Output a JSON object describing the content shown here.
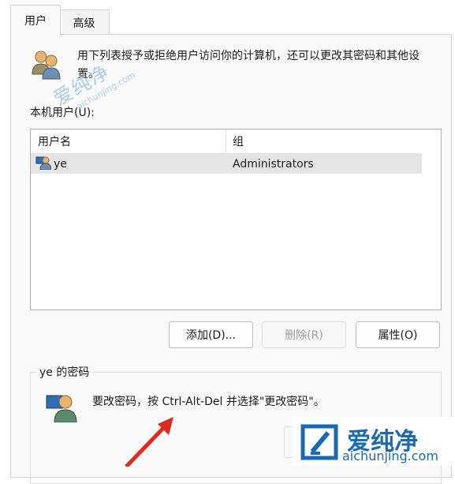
{
  "tabs": [
    {
      "label": "用户",
      "active": true
    },
    {
      "label": "高级",
      "active": false
    }
  ],
  "description": "用下列表授予或拒绝用户访问你的计算机，还可以更改其密码和其他设置。",
  "users_label": "本机用户(U):",
  "table": {
    "columns": [
      "用户名",
      "组"
    ],
    "rows": [
      {
        "user": "ye",
        "group": "Administrators"
      }
    ]
  },
  "buttons": {
    "add": "添加(D)...",
    "remove": "删除(R)",
    "properties": "属性(O)"
  },
  "password_group": {
    "title": "ye 的密码",
    "text": "要改密码，按 Ctrl-Alt-Del 并选择\"更改密码\"。"
  },
  "watermark": {
    "text": "爱纯净",
    "url": "aichunjing.com"
  },
  "logo": {
    "text": "爱纯净",
    "url": "aichunjing.com"
  },
  "colors": {
    "accent": "#1b6ab1",
    "arrow": "#e02a1e",
    "selection": "#e5e5e5"
  }
}
